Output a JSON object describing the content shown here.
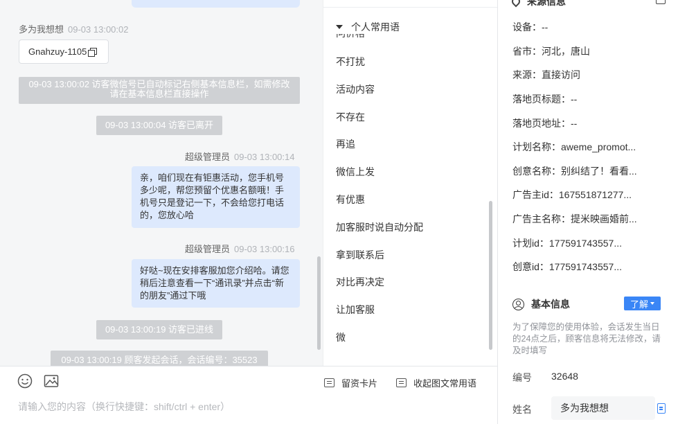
{
  "chat": {
    "wechat_msg": {
      "sender": "多为我想想",
      "time": "09-03 13:00:02",
      "card_text": "Gnahzuy-1105"
    },
    "sys_auto_tag": "09-03 13:00:02 访客微信号已自动标记右侧基本信息栏，如需修改请在基本信息栏直接操作",
    "sys_left": "09-03 13:00:04 访客已离开",
    "admin_msg_1": {
      "sender": "超级管理员",
      "time": "09-03 13:00:14",
      "text": "亲，咱们现在有钜惠活动，您手机号多少呢，帮您预留个优惠名额哦！手机号只是登记一下，不会给您打电话的，您放心哈"
    },
    "admin_msg_2": {
      "sender": "超级管理员",
      "time": "09-03 13:00:16",
      "text": "好哒~现在安排客服加您介绍哈。请您稍后注意查看一下“通讯录”并点击“新的朋友”通过下哦"
    },
    "sys_entered": "09-03 13:00:19 访客已进线",
    "sys_session": "09-03 13:00:19 顾客发起会话，会话编号：35523"
  },
  "phrases": {
    "header": "个人常用语",
    "partial_item": "问价格",
    "items": [
      "不打扰",
      "活动内容",
      "不存在",
      "再追",
      "微信上发",
      "有优惠",
      "加客服时说自动分配",
      "拿到联系后",
      "对比再决定",
      "让加客服",
      "微"
    ]
  },
  "toolbar": {
    "emoji_icon": "smile-icon",
    "image_icon": "image-icon",
    "lead_card": "留资卡片",
    "collapse_phrases": "收起图文常用语"
  },
  "input": {
    "placeholder": "请输入您的内容（换行快捷键：shift/ctrl + enter）"
  },
  "info": {
    "source_title": "来源信息",
    "source_rows": [
      "设备：--",
      "省市：河北，唐山",
      "来源：直接访问",
      "落地页标题：--",
      "落地页地址：--",
      "计划名称：aweme_promot...",
      "创意名称：别纠结了！看看...",
      "广告主id：167551871277...",
      "广告主名称：提米映画婚前...",
      "计划id：177591743557...",
      "创意id：177591743557..."
    ],
    "basic_title": "基本信息",
    "learn_more": "了解",
    "notice": "为了保障您的使用体验，会话发生当日的24点之后，顾客信息将无法修改，请及时填写",
    "id_label": "编号",
    "id_value": "32648",
    "name_label": "姓名",
    "name_value": "多为我想想"
  },
  "colors": {
    "accent": "#3a86f6",
    "bubble": "#dde9fd",
    "system_msg": "#cfd1d4",
    "chat_bg": "#f5f6f7"
  }
}
